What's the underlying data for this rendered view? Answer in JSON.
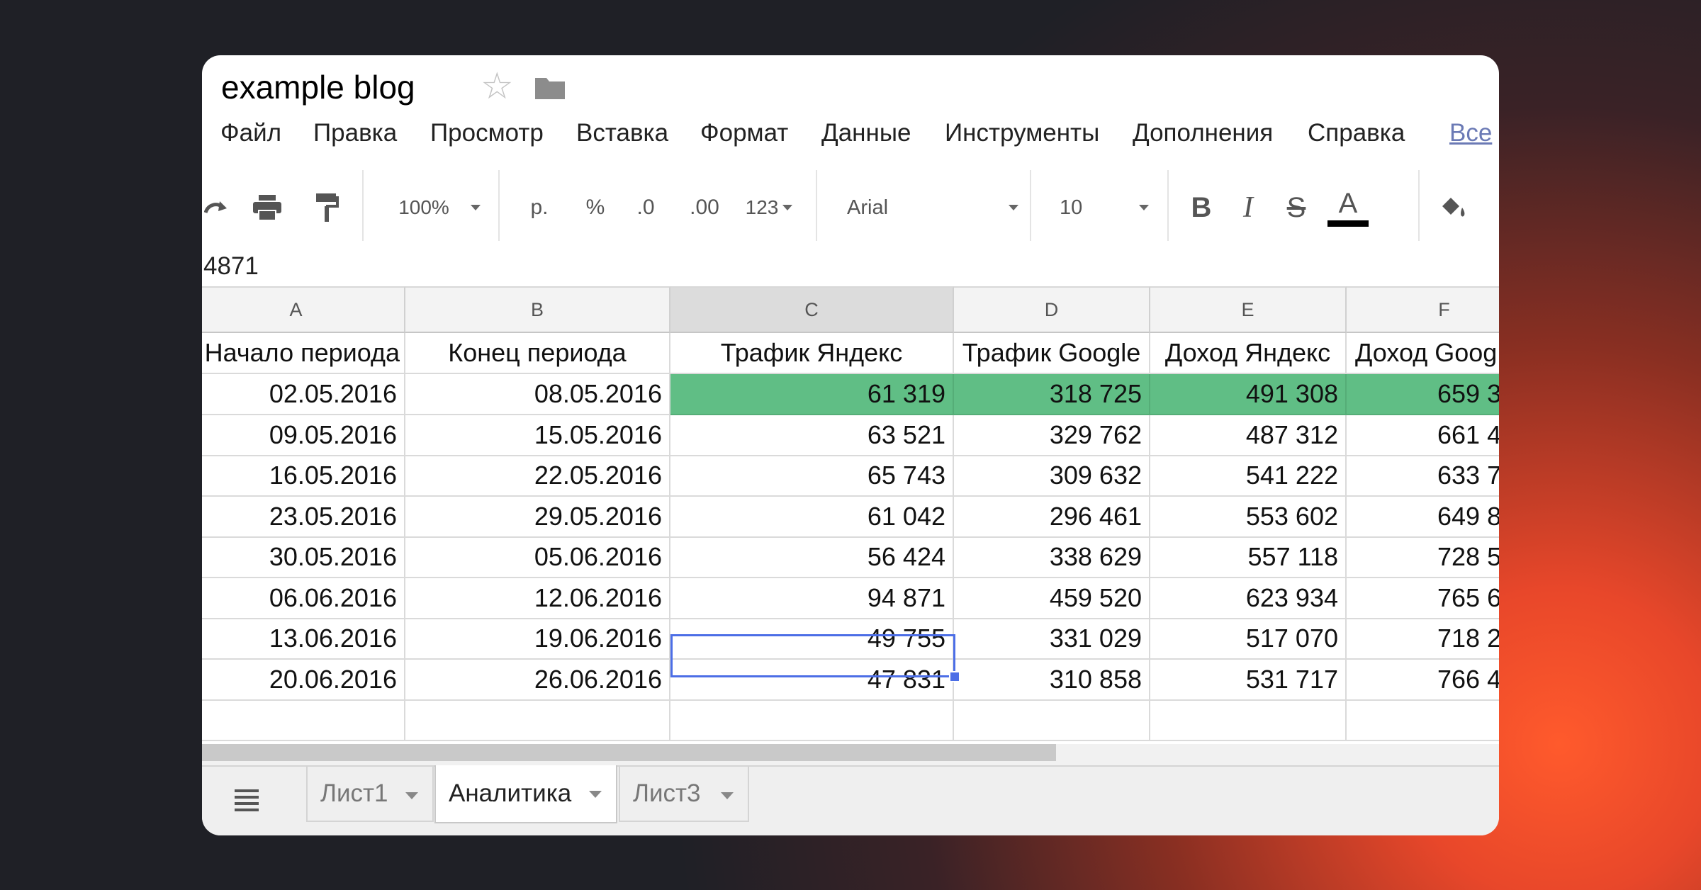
{
  "doc": {
    "title": "example blog"
  },
  "menu": [
    "Файл",
    "Правка",
    "Просмотр",
    "Вставка",
    "Формат",
    "Данные",
    "Инструменты",
    "Дополнения",
    "Справка",
    "Все"
  ],
  "toolbar": {
    "zoom": "100%",
    "currency": "р.",
    "percent": "%",
    "decrease_decimals": ".0",
    "increase_decimals": ".00",
    "more_formats": "123",
    "font": "Arial",
    "font_size": "10",
    "bold": "B",
    "italic": "I",
    "strike": "S",
    "text_color": "A",
    "text_color_value": "#000000"
  },
  "formula_bar": {
    "value": "4871"
  },
  "columns": [
    "A",
    "B",
    "C",
    "D",
    "E",
    "F"
  ],
  "headers": [
    "Начало периода",
    "Конец периода",
    "Трафик Яндекс",
    "Трафик Google",
    "Доход Яндекс",
    "Доход Goog"
  ],
  "rows": [
    [
      "02.05.2016",
      "08.05.2016",
      "61 319",
      "318 725",
      "491 308",
      "659 3"
    ],
    [
      "09.05.2016",
      "15.05.2016",
      "63 521",
      "329 762",
      "487 312",
      "661 4"
    ],
    [
      "16.05.2016",
      "22.05.2016",
      "65 743",
      "309 632",
      "541 222",
      "633 7"
    ],
    [
      "23.05.2016",
      "29.05.2016",
      "61 042",
      "296 461",
      "553 602",
      "649 8"
    ],
    [
      "30.05.2016",
      "05.06.2016",
      "56 424",
      "338 629",
      "557 118",
      "728 5"
    ],
    [
      "06.06.2016",
      "12.06.2016",
      "94 871",
      "459 520",
      "623 934",
      "765 6"
    ],
    [
      "13.06.2016",
      "19.06.2016",
      "49 755",
      "331 029",
      "517 070",
      "718 2"
    ],
    [
      "20.06.2016",
      "26.06.2016",
      "47 831",
      "310 858",
      "531 717",
      "766 4"
    ]
  ],
  "highlight_color": "#60be85",
  "selection_color": "#4c6ee6",
  "sheets": [
    "Лист1",
    "Аналитика",
    "Лист3"
  ],
  "active_sheet": "Аналитика"
}
